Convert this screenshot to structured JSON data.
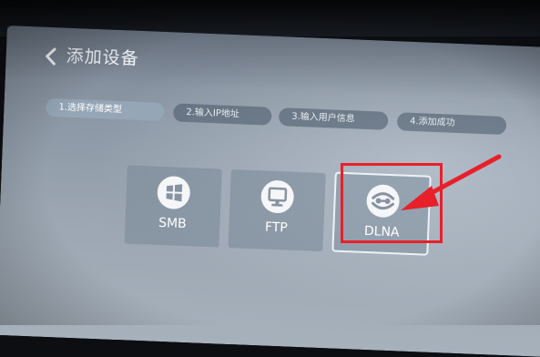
{
  "header": {
    "title": "添加设备",
    "back_icon": "chevron-left-icon"
  },
  "steps": [
    {
      "label": "1.选择存储类型",
      "active": true
    },
    {
      "label": "2.输入IP地址",
      "active": false
    },
    {
      "label": "3.输入用户信息",
      "active": false
    },
    {
      "label": "4.添加成功",
      "active": false
    }
  ],
  "devices": [
    {
      "label": "SMB",
      "icon": "windows-icon"
    },
    {
      "label": "FTP",
      "icon": "monitor-icon"
    },
    {
      "label": "DLNA",
      "icon": "dlna-icon",
      "selected": true
    }
  ],
  "colors": {
    "annotation": "#e8202a",
    "pill_active": "#96a8ba",
    "screen": "#8d98a6"
  }
}
